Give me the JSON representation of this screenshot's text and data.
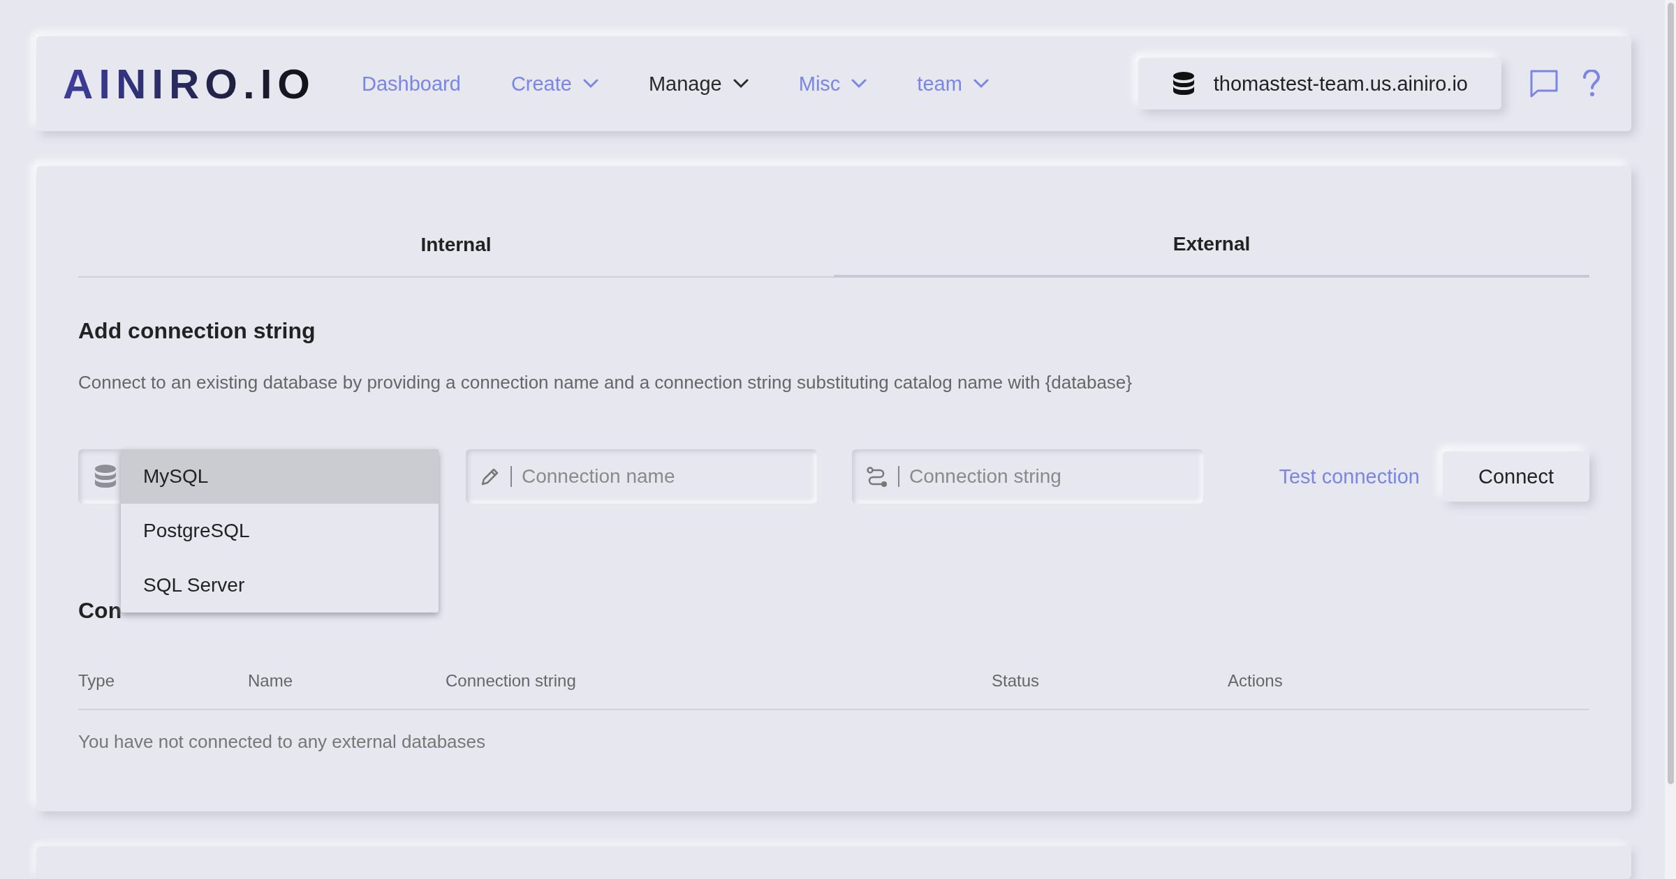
{
  "header": {
    "logo": "AINIRO.IO",
    "nav": [
      {
        "label": "Dashboard",
        "dropdown": false,
        "selected": false
      },
      {
        "label": "Create",
        "dropdown": true,
        "selected": false
      },
      {
        "label": "Manage",
        "dropdown": true,
        "selected": true
      },
      {
        "label": "Misc",
        "dropdown": true,
        "selected": false
      },
      {
        "label": "team",
        "dropdown": true,
        "selected": false
      }
    ],
    "server": "thomastest-team.us.ainiro.io"
  },
  "tabs": [
    {
      "label": "Internal",
      "selected": false
    },
    {
      "label": "External",
      "selected": true
    }
  ],
  "add_section": {
    "title": "Add connection string",
    "description": "Connect to an existing database by providing a connection name and a connection string substituting catalog name with {database}",
    "type_options": [
      {
        "label": "MySQL",
        "selected": true
      },
      {
        "label": "PostgreSQL",
        "selected": false
      },
      {
        "label": "SQL Server",
        "selected": false
      }
    ],
    "name_field": {
      "placeholder": "Connection name"
    },
    "string_field": {
      "placeholder": "Connection string"
    },
    "test_link": "Test connection",
    "connect_button": "Connect"
  },
  "list_section": {
    "title": "Con",
    "columns": [
      "Type",
      "Name",
      "Connection string",
      "Status",
      "Actions"
    ],
    "empty_message": "You have not connected to any external databases"
  }
}
